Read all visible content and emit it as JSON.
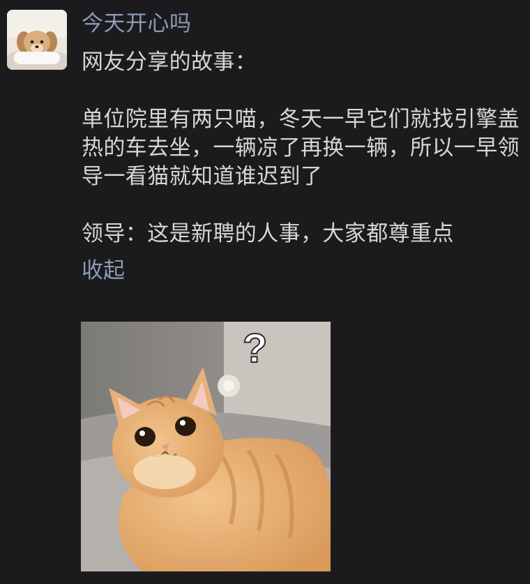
{
  "post": {
    "username": "今天开心吗",
    "paragraphs": [
      "网友分享的故事：",
      "单位院里有两只喵，冬天一早它们就找引擎盖热的车去坐，一辆凉了再换一辆，所以一早领导一看猫就知道谁迟到了",
      "领导：这是新聘的人事，大家都尊重点"
    ],
    "collapse_label": "收起"
  },
  "avatar": {
    "icon": "puppy-avatar-icon"
  },
  "image": {
    "icon": "surprised-cat-photo",
    "question_mark": "?"
  },
  "colors": {
    "background": "#1b1b1d",
    "username": "#8c9ab6",
    "text": "#d6d6d6",
    "link": "#8c9ab6"
  }
}
